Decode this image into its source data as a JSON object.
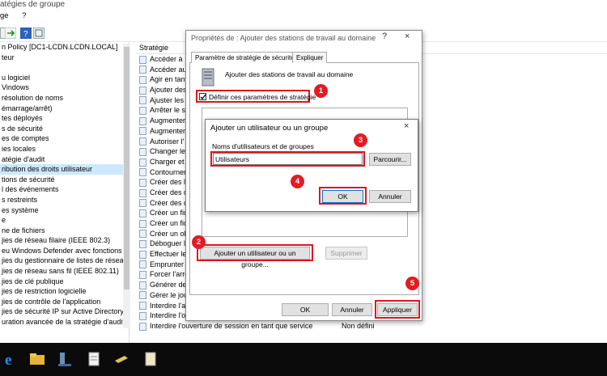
{
  "window": {
    "title": "atégies de groupe",
    "menu": [
      "ge",
      "?"
    ]
  },
  "tree": {
    "items": [
      "n Policy [DC1-LCDN.LCDN.LOCAL]",
      "teur",
      "",
      "u logiciel",
      "Vindows",
      "résolution de noms",
      "émarrage/arrêt)",
      "tes déployés",
      "s de sécurité",
      "es de comptes",
      "ies locales",
      "atégie d'audit",
      "ribution des droits utilisateur",
      "tions de sécurité",
      "l des événements",
      "s restreints",
      "es système",
      "e",
      "ne de fichiers",
      "jies de réseau filaire (IEEE 802.3)",
      "eu Windows Defender avec fonctions ava",
      "jies du gestionnaire de listes de réseaux",
      "jies de réseau sans fil (IEEE 802.11)",
      "jies de clé publique",
      "jies de restriction logicielle",
      "jies de contrôle de l'application",
      "jies de sécurité IP sur Active Directory (LC",
      "uration avancée de la stratégie d'audit"
    ],
    "selected_index": 12
  },
  "list": {
    "column_header": "Stratégie",
    "rows": [
      {
        "name": "Accéder à",
        "value": ""
      },
      {
        "name": "Accéder au",
        "value": ""
      },
      {
        "name": "Agir en tant",
        "value": ""
      },
      {
        "name": "Ajouter des",
        "value": ""
      },
      {
        "name": "Ajuster les",
        "value": ""
      },
      {
        "name": "Arrêter le sy",
        "value": ""
      },
      {
        "name": "Augmenter",
        "value": ""
      },
      {
        "name": "Augmenter",
        "value": ""
      },
      {
        "name": "Autoriser l'",
        "value": ""
      },
      {
        "name": "Changer le",
        "value": ""
      },
      {
        "name": "Charger et",
        "value": ""
      },
      {
        "name": "Contourner",
        "value": ""
      },
      {
        "name": "Créer des li",
        "value": ""
      },
      {
        "name": "Créer des ol",
        "value": ""
      },
      {
        "name": "Créer des ol",
        "value": ""
      },
      {
        "name": "Créer un fic",
        "value": ""
      },
      {
        "name": "Créer un fic",
        "value": ""
      },
      {
        "name": "Créer un ob",
        "value": ""
      },
      {
        "name": "Déboguer le",
        "value": ""
      },
      {
        "name": "Effectuer les",
        "value": ""
      },
      {
        "name": "Emprunter l'",
        "value": ""
      },
      {
        "name": "Forcer l'arré",
        "value": ""
      },
      {
        "name": "Générer des",
        "value": ""
      },
      {
        "name": "Gérer le jou",
        "value": ""
      },
      {
        "name": "Interdire l'a",
        "value": ""
      },
      {
        "name": "Interdire l'ouverture d'une session locale",
        "value": "Non défini"
      },
      {
        "name": "Interdire l'ouverture de session en tant que service",
        "value": "Non défini"
      }
    ]
  },
  "dialog_props": {
    "title": "Propriétés de : Ajouter des stations de travail au domaine",
    "help": "?",
    "close": "×",
    "tabs": [
      "Paramètre de stratégie de sécurité",
      "Expliquer"
    ],
    "policy_name": "Ajouter des stations de travail au domaine",
    "define_checkbox_label": "Définir ces paramètres de stratégie",
    "add_button": "Ajouter un utilisateur ou un groupe...",
    "remove_button": "Supprimer",
    "ok": "OK",
    "cancel": "Annuler",
    "apply": "Appliquer"
  },
  "dialog_add": {
    "title": "Ajouter un utilisateur ou un groupe",
    "close": "×",
    "field_label": "Noms d'utilisateurs et de groupes",
    "field_value": "Utilisateurs",
    "browse": "Parcourir...",
    "ok": "OK",
    "cancel": "Annuler"
  },
  "steps": [
    "1",
    "2",
    "3",
    "4",
    "5"
  ],
  "colors": {
    "highlight_red": "#e0141e",
    "badge_red": "#e31b23",
    "selection": "#cce8ff",
    "taskbar": "#0b0b0b"
  }
}
